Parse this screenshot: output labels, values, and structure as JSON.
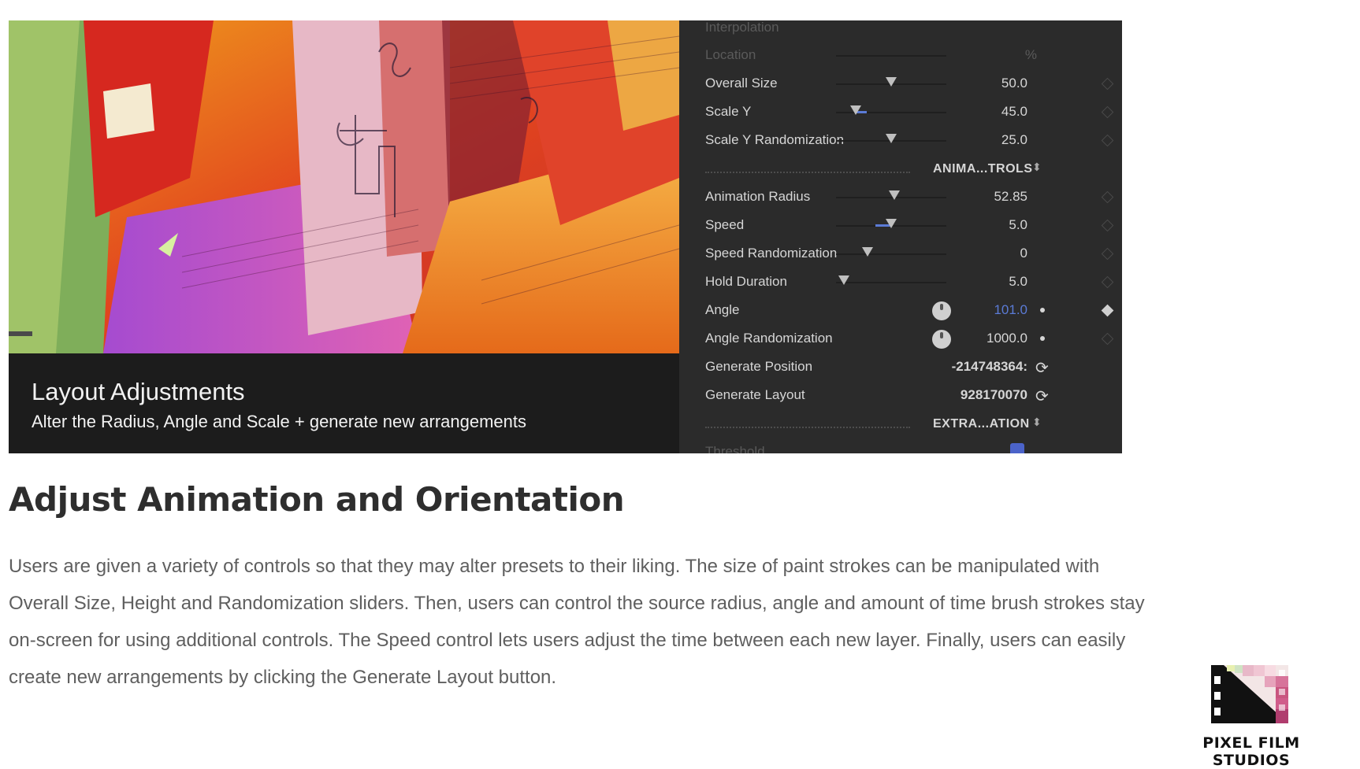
{
  "hero": {
    "caption_title": "Layout Adjustments",
    "caption_subtitle": "Alter the Radius, Angle and Scale + generate new arrangements"
  },
  "inspector": {
    "rows": [
      {
        "label": "Interpolation",
        "value": ""
      },
      {
        "label": "Location",
        "value": "%"
      },
      {
        "label": "Overall Size",
        "value": "50.0",
        "fraction": 0.5
      },
      {
        "label": "Scale Y",
        "value": "45.0",
        "fraction": 0.18
      },
      {
        "label": "Scale Y Randomization",
        "value": "25.0",
        "fraction": 0.5
      },
      {
        "label": "Animation Radius",
        "value": "52.85",
        "fraction": 0.53
      },
      {
        "label": "Speed",
        "value": "5.0",
        "fraction": 0.5
      },
      {
        "label": "Speed Randomization",
        "value": "0",
        "fraction": 0.28
      },
      {
        "label": "Hold Duration",
        "value": "5.0",
        "fraction": 0.07
      },
      {
        "label": "Angle",
        "value": "101.0"
      },
      {
        "label": "Angle Randomization",
        "value": "1000.0"
      },
      {
        "label": "Generate Position",
        "value": "-214748364:"
      },
      {
        "label": "Generate Layout",
        "value": "928170070"
      },
      {
        "label": "Threshold",
        "value": ""
      }
    ],
    "groups": [
      "ANIMA...TROLS",
      "EXTRA...ATION"
    ],
    "colors": {
      "panel": "#2b2b2b",
      "accent_blue": "#5b7bd6"
    }
  },
  "article": {
    "heading": "Adjust Animation and Orientation",
    "paragraph": "Users are given a variety of controls so that they may alter presets to their liking. The size of paint strokes can be manipulated with Overall Size, Height and Randomization sliders. Then, users can control the source radius, angle and amount of time brush strokes stay on-screen for using additional controls. The Speed control lets users adjust the time between each new layer. Finally, users can easily create new arrangements by clicking the Generate Layout button."
  },
  "logo": {
    "text": "PIXEL FILM STUDIOS",
    "icon": "film-clapper-icon"
  }
}
